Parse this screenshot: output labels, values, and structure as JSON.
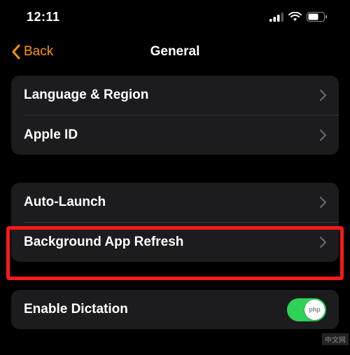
{
  "statusBar": {
    "time": "12:11"
  },
  "nav": {
    "back": "Back",
    "title": "General"
  },
  "section1": {
    "rows": [
      {
        "label": "Language & Region"
      },
      {
        "label": "Apple ID"
      }
    ]
  },
  "section2": {
    "rows": [
      {
        "label": "Auto-Launch"
      },
      {
        "label": "Background App Refresh"
      }
    ]
  },
  "section3": {
    "rows": [
      {
        "label": "Enable Dictation"
      }
    ]
  },
  "toggleKnob": "php",
  "watermark": "中文网"
}
